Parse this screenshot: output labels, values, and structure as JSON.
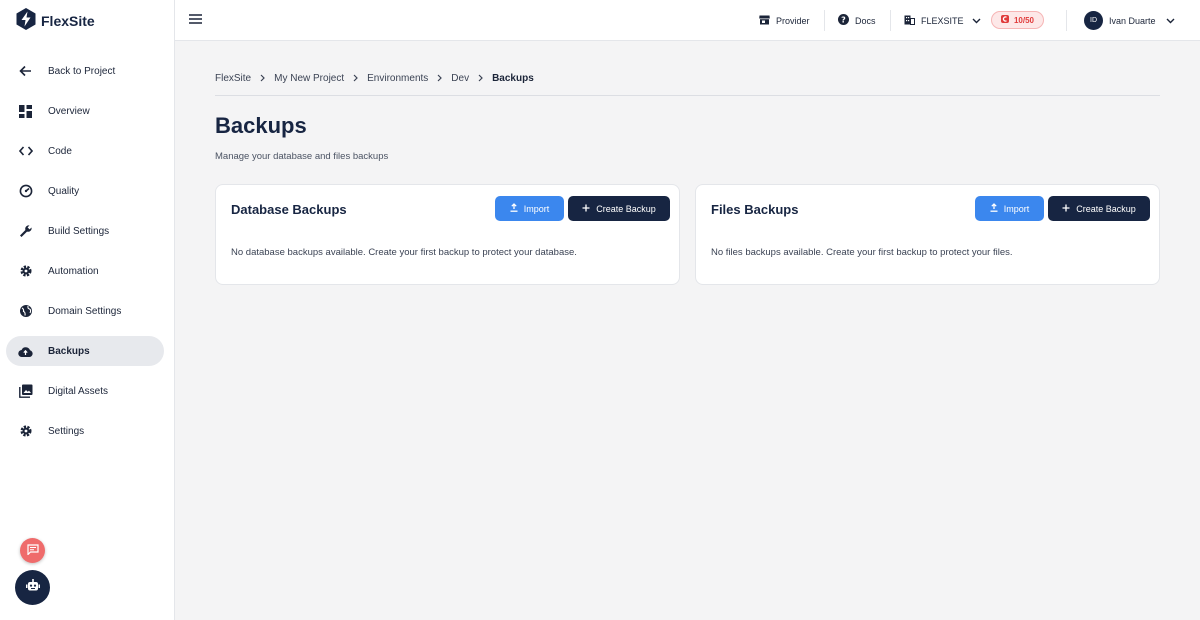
{
  "brand": {
    "name": "FlexSite"
  },
  "sidebar": {
    "items": [
      {
        "label": "Back to Project",
        "icon": "arrow-left-icon"
      },
      {
        "label": "Overview",
        "icon": "dashboard-icon"
      },
      {
        "label": "Code",
        "icon": "code-icon"
      },
      {
        "label": "Quality",
        "icon": "gauge-icon"
      },
      {
        "label": "Build Settings",
        "icon": "wrench-icon"
      },
      {
        "label": "Automation",
        "icon": "gear-icon"
      },
      {
        "label": "Domain Settings",
        "icon": "globe-icon"
      },
      {
        "label": "Backups",
        "icon": "cloud-upload-icon",
        "active": true
      },
      {
        "label": "Digital Assets",
        "icon": "image-library-icon"
      },
      {
        "label": "Settings",
        "icon": "gear-icon"
      }
    ]
  },
  "topbar": {
    "provider": "Provider",
    "docs": "Docs",
    "org": "FLEXSITE",
    "credits": "10/50",
    "user": {
      "initials": "ID",
      "name": "Ivan Duarte"
    }
  },
  "breadcrumb": [
    "FlexSite",
    "My New Project",
    "Environments",
    "Dev",
    "Backups"
  ],
  "page": {
    "title": "Backups",
    "subtitle": "Manage your database and files backups"
  },
  "cards": {
    "database": {
      "title": "Database Backups",
      "import_label": "Import",
      "create_label": "Create Backup",
      "empty_message": "No database backups available. Create your first backup to protect your database."
    },
    "files": {
      "title": "Files Backups",
      "import_label": "Import",
      "create_label": "Create Backup",
      "empty_message": "No files backups available. Create your first backup to protect your files."
    }
  },
  "colors": {
    "navy": "#172542",
    "primary_blue": "#3b87ee",
    "active_bg": "#e7e9ed",
    "credits_red": "#e03c3c",
    "chat_fab": "#ef6b6b"
  }
}
